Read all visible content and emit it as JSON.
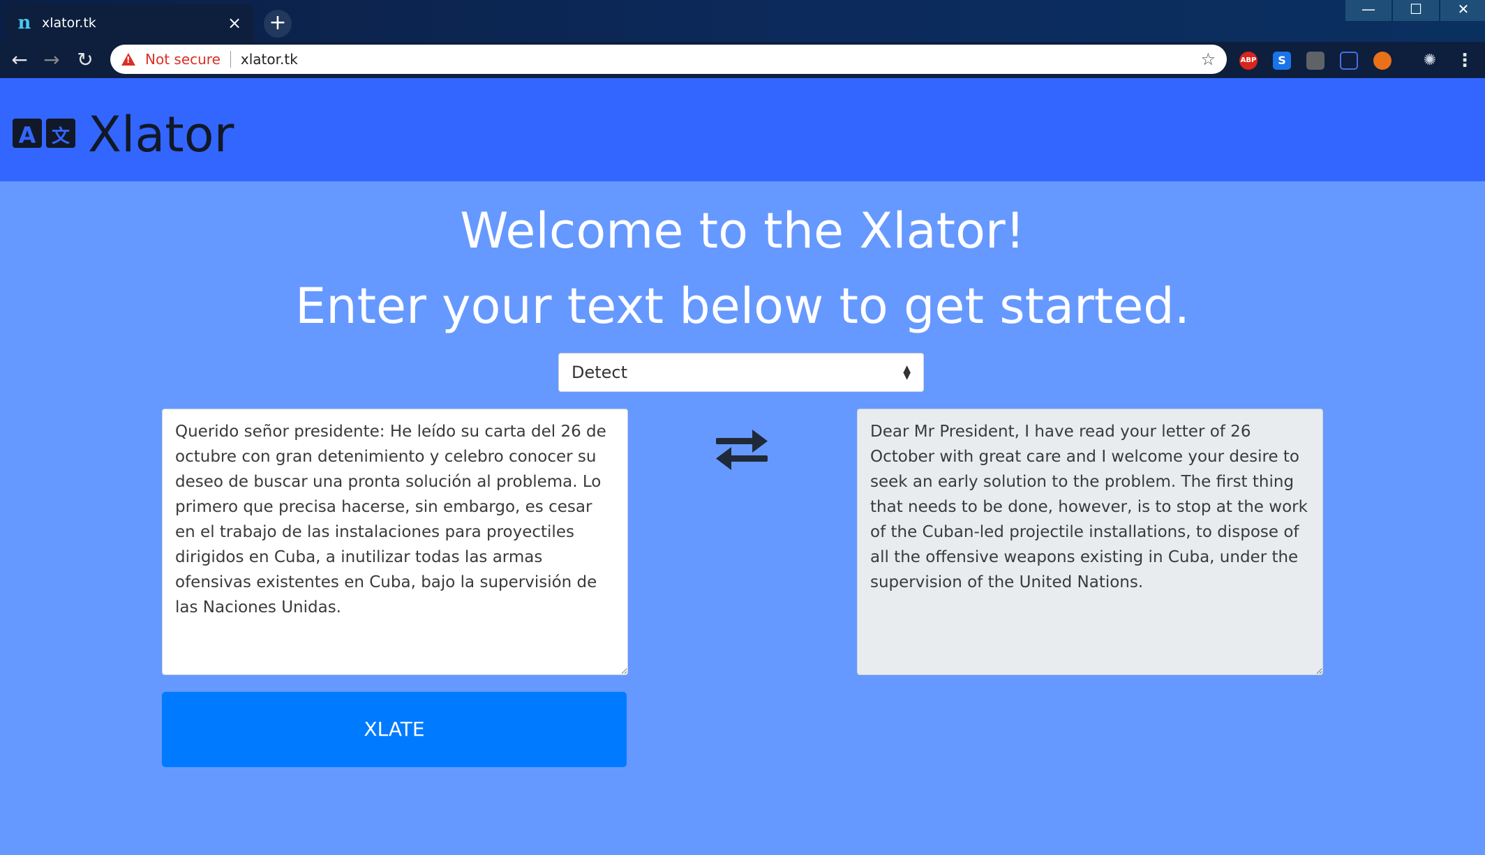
{
  "browser": {
    "tab_title": "xlator.tk",
    "new_tab": "+",
    "not_secure": "Not secure",
    "url": "xlator.tk",
    "extensions": [
      "ABP",
      "S"
    ]
  },
  "header": {
    "brand": "Xlator"
  },
  "main": {
    "welcome": "Welcome to the Xlator!",
    "subtitle": "Enter your text below to get started.",
    "language_select": {
      "value": "Detect"
    },
    "source_text": "Querido señor presidente: He leído su carta del 26 de octubre con gran detenimiento y celebro conocer su deseo de buscar una pronta solución al problema. Lo primero que precisa hacerse, sin embargo, es cesar en el trabajo de las instalaciones para proyectiles dirigidos en Cuba, a inutilizar todas las armas ofensivas existentes en Cuba, bajo la supervisión de las Naciones Unidas.",
    "translated_text": "Dear Mr President, I have read your letter of 26 October with great care and I welcome your desire to seek an early solution to the problem. The first thing that needs to be done, however, is to stop at the work of the Cuban-led projectile installations, to dispose of all the offensive weapons existing in Cuba, under the supervision of the United Nations.",
    "xlate_button": "XLATE"
  },
  "colors": {
    "header_bg": "#3366ff",
    "page_bg": "#6699ff",
    "button_bg": "#007bff"
  }
}
